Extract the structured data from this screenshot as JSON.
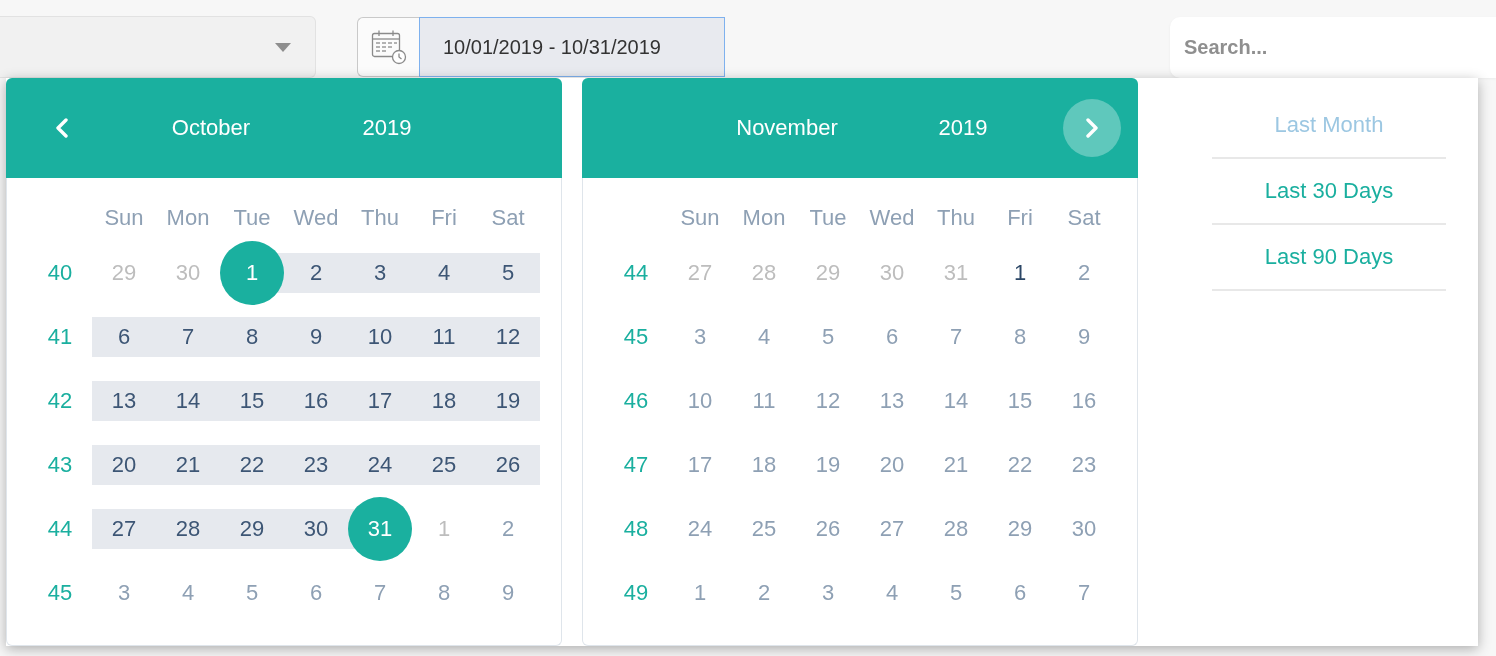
{
  "toolbar": {
    "dropdown": {
      "expanded": false
    },
    "date_range": {
      "value": "10/01/2019 - 10/31/2019",
      "focused": true
    },
    "search": {
      "placeholder": "Search..."
    }
  },
  "date_picker": {
    "calendars": [
      {
        "nav": {
          "kind": "prev",
          "hovered": false
        },
        "month": "October",
        "year": "2019",
        "weekdays": [
          "Sun",
          "Mon",
          "Tue",
          "Wed",
          "Thu",
          "Fri",
          "Sat"
        ],
        "weeks": [
          {
            "number": "40",
            "days": [
              {
                "text": "29",
                "kind": "outside",
                "selected": false,
                "in_range": false
              },
              {
                "text": "30",
                "kind": "outside",
                "selected": false,
                "in_range": false
              },
              {
                "text": "1",
                "kind": "normal",
                "selected": true,
                "in_range": true
              },
              {
                "text": "2",
                "kind": "normal",
                "selected": false,
                "in_range": true
              },
              {
                "text": "3",
                "kind": "normal",
                "selected": false,
                "in_range": true
              },
              {
                "text": "4",
                "kind": "normal",
                "selected": false,
                "in_range": true
              },
              {
                "text": "5",
                "kind": "normal",
                "selected": false,
                "in_range": true
              }
            ]
          },
          {
            "number": "41",
            "days": [
              {
                "text": "6",
                "kind": "normal",
                "selected": false,
                "in_range": true
              },
              {
                "text": "7",
                "kind": "normal",
                "selected": false,
                "in_range": true
              },
              {
                "text": "8",
                "kind": "normal",
                "selected": false,
                "in_range": true
              },
              {
                "text": "9",
                "kind": "normal",
                "selected": false,
                "in_range": true
              },
              {
                "text": "10",
                "kind": "normal",
                "selected": false,
                "in_range": true
              },
              {
                "text": "11",
                "kind": "normal",
                "selected": false,
                "in_range": true
              },
              {
                "text": "12",
                "kind": "normal",
                "selected": false,
                "in_range": true
              }
            ]
          },
          {
            "number": "42",
            "days": [
              {
                "text": "13",
                "kind": "normal",
                "selected": false,
                "in_range": true
              },
              {
                "text": "14",
                "kind": "normal",
                "selected": false,
                "in_range": true
              },
              {
                "text": "15",
                "kind": "normal",
                "selected": false,
                "in_range": true
              },
              {
                "text": "16",
                "kind": "normal",
                "selected": false,
                "in_range": true
              },
              {
                "text": "17",
                "kind": "normal",
                "selected": false,
                "in_range": true
              },
              {
                "text": "18",
                "kind": "normal",
                "selected": false,
                "in_range": true
              },
              {
                "text": "19",
                "kind": "normal",
                "selected": false,
                "in_range": true
              }
            ]
          },
          {
            "number": "43",
            "days": [
              {
                "text": "20",
                "kind": "normal",
                "selected": false,
                "in_range": true
              },
              {
                "text": "21",
                "kind": "normal",
                "selected": false,
                "in_range": true
              },
              {
                "text": "22",
                "kind": "normal",
                "selected": false,
                "in_range": true
              },
              {
                "text": "23",
                "kind": "normal",
                "selected": false,
                "in_range": true
              },
              {
                "text": "24",
                "kind": "normal",
                "selected": false,
                "in_range": true
              },
              {
                "text": "25",
                "kind": "normal",
                "selected": false,
                "in_range": true
              },
              {
                "text": "26",
                "kind": "normal",
                "selected": false,
                "in_range": true
              }
            ]
          },
          {
            "number": "44",
            "days": [
              {
                "text": "27",
                "kind": "normal",
                "selected": false,
                "in_range": true
              },
              {
                "text": "28",
                "kind": "normal",
                "selected": false,
                "in_range": true
              },
              {
                "text": "29",
                "kind": "normal",
                "selected": false,
                "in_range": true
              },
              {
                "text": "30",
                "kind": "normal",
                "selected": false,
                "in_range": true
              },
              {
                "text": "31",
                "kind": "normal",
                "selected": true,
                "in_range": true
              },
              {
                "text": "1",
                "kind": "outside",
                "selected": false,
                "in_range": false
              },
              {
                "text": "2",
                "kind": "normal",
                "selected": false,
                "in_range": false
              }
            ]
          },
          {
            "number": "45",
            "days": [
              {
                "text": "3",
                "kind": "normal",
                "selected": false,
                "in_range": false
              },
              {
                "text": "4",
                "kind": "normal",
                "selected": false,
                "in_range": false
              },
              {
                "text": "5",
                "kind": "normal",
                "selected": false,
                "in_range": false
              },
              {
                "text": "6",
                "kind": "normal",
                "selected": false,
                "in_range": false
              },
              {
                "text": "7",
                "kind": "normal",
                "selected": false,
                "in_range": false
              },
              {
                "text": "8",
                "kind": "normal",
                "selected": false,
                "in_range": false
              },
              {
                "text": "9",
                "kind": "normal",
                "selected": false,
                "in_range": false
              }
            ]
          }
        ]
      },
      {
        "nav": {
          "kind": "next",
          "hovered": true
        },
        "month": "November",
        "year": "2019",
        "weekdays": [
          "Sun",
          "Mon",
          "Tue",
          "Wed",
          "Thu",
          "Fri",
          "Sat"
        ],
        "weeks": [
          {
            "number": "44",
            "days": [
              {
                "text": "27",
                "kind": "outside",
                "selected": false,
                "in_range": false
              },
              {
                "text": "28",
                "kind": "outside",
                "selected": false,
                "in_range": false
              },
              {
                "text": "29",
                "kind": "outside",
                "selected": false,
                "in_range": false
              },
              {
                "text": "30",
                "kind": "outside",
                "selected": false,
                "in_range": false
              },
              {
                "text": "31",
                "kind": "outside",
                "selected": false,
                "in_range": false
              },
              {
                "text": "1",
                "kind": "today",
                "selected": false,
                "in_range": false
              },
              {
                "text": "2",
                "kind": "normal",
                "selected": false,
                "in_range": false
              }
            ]
          },
          {
            "number": "45",
            "days": [
              {
                "text": "3",
                "kind": "normal",
                "selected": false,
                "in_range": false
              },
              {
                "text": "4",
                "kind": "normal",
                "selected": false,
                "in_range": false
              },
              {
                "text": "5",
                "kind": "normal",
                "selected": false,
                "in_range": false
              },
              {
                "text": "6",
                "kind": "normal",
                "selected": false,
                "in_range": false
              },
              {
                "text": "7",
                "kind": "normal",
                "selected": false,
                "in_range": false
              },
              {
                "text": "8",
                "kind": "normal",
                "selected": false,
                "in_range": false
              },
              {
                "text": "9",
                "kind": "normal",
                "selected": false,
                "in_range": false
              }
            ]
          },
          {
            "number": "46",
            "days": [
              {
                "text": "10",
                "kind": "normal",
                "selected": false,
                "in_range": false
              },
              {
                "text": "11",
                "kind": "normal",
                "selected": false,
                "in_range": false
              },
              {
                "text": "12",
                "kind": "normal",
                "selected": false,
                "in_range": false
              },
              {
                "text": "13",
                "kind": "normal",
                "selected": false,
                "in_range": false
              },
              {
                "text": "14",
                "kind": "normal",
                "selected": false,
                "in_range": false
              },
              {
                "text": "15",
                "kind": "normal",
                "selected": false,
                "in_range": false
              },
              {
                "text": "16",
                "kind": "normal",
                "selected": false,
                "in_range": false
              }
            ]
          },
          {
            "number": "47",
            "days": [
              {
                "text": "17",
                "kind": "normal",
                "selected": false,
                "in_range": false
              },
              {
                "text": "18",
                "kind": "normal",
                "selected": false,
                "in_range": false
              },
              {
                "text": "19",
                "kind": "normal",
                "selected": false,
                "in_range": false
              },
              {
                "text": "20",
                "kind": "normal",
                "selected": false,
                "in_range": false
              },
              {
                "text": "21",
                "kind": "normal",
                "selected": false,
                "in_range": false
              },
              {
                "text": "22",
                "kind": "normal",
                "selected": false,
                "in_range": false
              },
              {
                "text": "23",
                "kind": "normal",
                "selected": false,
                "in_range": false
              }
            ]
          },
          {
            "number": "48",
            "days": [
              {
                "text": "24",
                "kind": "normal",
                "selected": false,
                "in_range": false
              },
              {
                "text": "25",
                "kind": "normal",
                "selected": false,
                "in_range": false
              },
              {
                "text": "26",
                "kind": "normal",
                "selected": false,
                "in_range": false
              },
              {
                "text": "27",
                "kind": "normal",
                "selected": false,
                "in_range": false
              },
              {
                "text": "28",
                "kind": "normal",
                "selected": false,
                "in_range": false
              },
              {
                "text": "29",
                "kind": "normal",
                "selected": false,
                "in_range": false
              },
              {
                "text": "30",
                "kind": "normal",
                "selected": false,
                "in_range": false
              }
            ]
          },
          {
            "number": "49",
            "days": [
              {
                "text": "1",
                "kind": "normal",
                "selected": false,
                "in_range": false
              },
              {
                "text": "2",
                "kind": "normal",
                "selected": false,
                "in_range": false
              },
              {
                "text": "3",
                "kind": "normal",
                "selected": false,
                "in_range": false
              },
              {
                "text": "4",
                "kind": "normal",
                "selected": false,
                "in_range": false
              },
              {
                "text": "5",
                "kind": "normal",
                "selected": false,
                "in_range": false
              },
              {
                "text": "6",
                "kind": "normal",
                "selected": false,
                "in_range": false
              },
              {
                "text": "7",
                "kind": "normal",
                "selected": false,
                "in_range": false
              }
            ]
          }
        ]
      }
    ],
    "presets": [
      {
        "label": "Last Month",
        "selected": true
      },
      {
        "label": "Last 30 Days",
        "selected": false
      },
      {
        "label": "Last 90 Days",
        "selected": false
      }
    ]
  }
}
